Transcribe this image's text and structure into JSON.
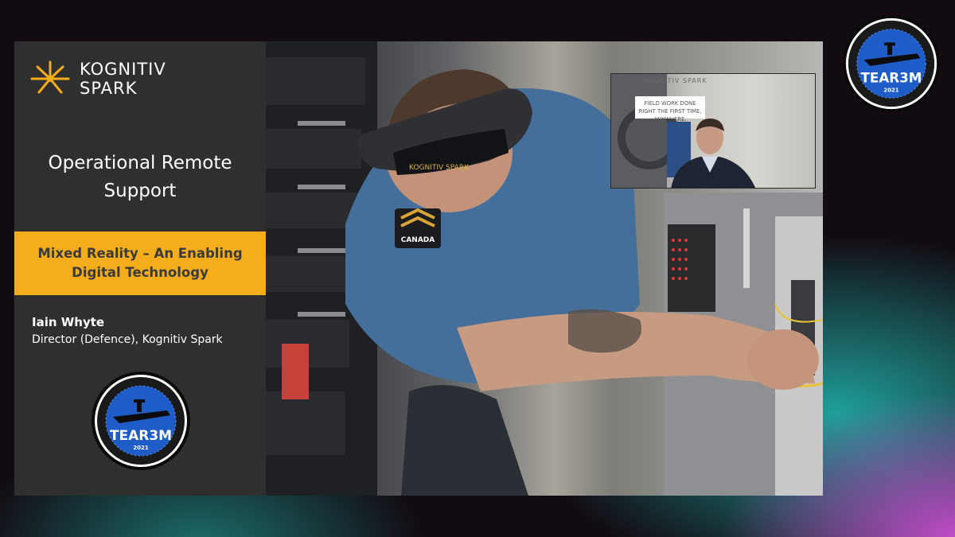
{
  "brand": {
    "line1": "KOGNITIV",
    "line2": "SPARK",
    "accent_color": "#f5ad1b"
  },
  "slide": {
    "title": "Operational Remote Support",
    "subtitle": "Mixed Reality – An Enabling Digital Technology",
    "speaker_name": "Iain Whyte",
    "speaker_role": "Director (Defence), Kognitiv Spark"
  },
  "badge": {
    "name": "TEAR3M",
    "year": "2021",
    "ring_color": "#1e5cc8"
  },
  "photo": {
    "headset_label": "KOGNITIV SPARK",
    "shoulder_label": "CANADA"
  },
  "webcam": {
    "logo_text": "KOGNITIV SPARK",
    "tagline": "FIELD WORK DONE RIGHT THE FIRST TIME, ANYWHERE."
  }
}
